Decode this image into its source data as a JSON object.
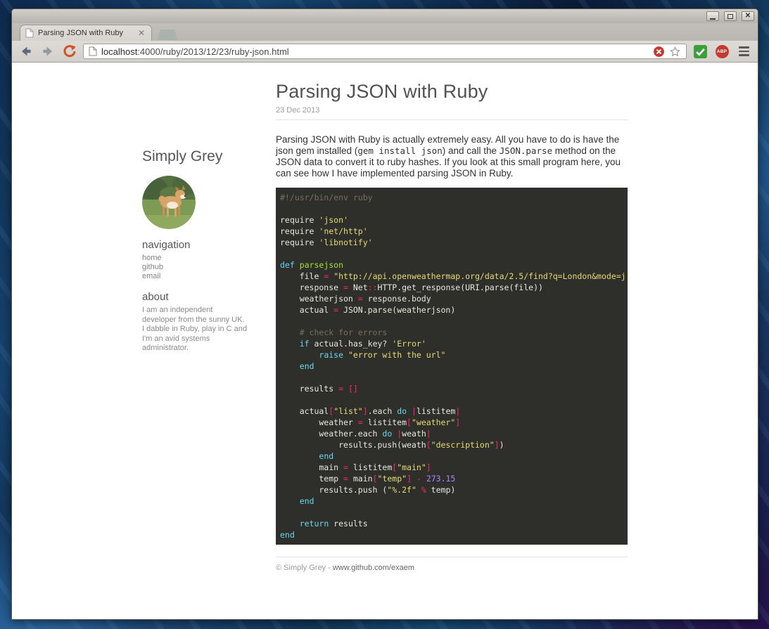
{
  "window_controls": {
    "minimize": "minimize",
    "maximize": "maximize",
    "close": "close"
  },
  "browser": {
    "tab_title": "Parsing JSON with Ruby",
    "url_domain": "localhost",
    "url_path": ":4000/ruby/2013/12/23/ruby-json.html",
    "abp_label": "ABP"
  },
  "sidebar": {
    "title": "Simply Grey",
    "nav_heading": "navigation",
    "nav_links": [
      {
        "label": "home"
      },
      {
        "label": "github"
      },
      {
        "label": "email"
      }
    ],
    "about_heading": "about",
    "about_text": "I am an independent developer from the sunny UK. I dabble in Ruby, play in C and I'm an avid systems administrator."
  },
  "post": {
    "title": "Parsing JSON with Ruby",
    "date": "23 Dec 2013",
    "intro": {
      "t1": "Parsing JSON with Ruby is actually extremely easy. All you have to do is have the json gem installed (",
      "c1": "gem install json",
      "t2": ") and call the ",
      "c2": "JSON.parse",
      "t3": " method on the JSON data to convert it to ruby hashes. If you look at this small program here, you can see how I have implemented parsing JSON in Ruby."
    },
    "code_theme": {
      "background": "#2e2e2a",
      "plain": "#e8e8e2",
      "comment": "#75715e",
      "string": "#e6db74",
      "keyword": "#66d9ef",
      "function": "#a6e22e",
      "operator": "#f92672",
      "number": "#ae81ff"
    },
    "code_lines": [
      [
        [
          "c",
          "#!/usr/bin/env ruby"
        ]
      ],
      [],
      [
        [
          "p",
          "require "
        ],
        [
          "s",
          "'json'"
        ]
      ],
      [
        [
          "p",
          "require "
        ],
        [
          "s",
          "'net/http'"
        ]
      ],
      [
        [
          "p",
          "require "
        ],
        [
          "s",
          "'libnotify'"
        ]
      ],
      [],
      [
        [
          "k",
          "def "
        ],
        [
          "f",
          "parsejson"
        ]
      ],
      [
        [
          "p",
          "    file "
        ],
        [
          "o",
          "="
        ],
        [
          "p",
          " "
        ],
        [
          "s",
          "\"http://api.openweathermap.org/data/2.5/find?q=London&mode=j"
        ]
      ],
      [
        [
          "p",
          "    response "
        ],
        [
          "o",
          "="
        ],
        [
          "p",
          " Net"
        ],
        [
          "o",
          "::"
        ],
        [
          "p",
          "HTTP.get_response(URI.parse(file))"
        ]
      ],
      [
        [
          "p",
          "    weatherjson "
        ],
        [
          "o",
          "="
        ],
        [
          "p",
          " response.body"
        ]
      ],
      [
        [
          "p",
          "    actual "
        ],
        [
          "o",
          "="
        ],
        [
          "p",
          " JSON.parse(weatherjson)"
        ]
      ],
      [],
      [
        [
          "p",
          "    "
        ],
        [
          "c",
          "# check for errors"
        ]
      ],
      [
        [
          "p",
          "    "
        ],
        [
          "k",
          "if"
        ],
        [
          "p",
          " actual.has_key? "
        ],
        [
          "s",
          "'Error'"
        ]
      ],
      [
        [
          "p",
          "        "
        ],
        [
          "k",
          "raise"
        ],
        [
          "p",
          " "
        ],
        [
          "s",
          "\"error with the url\""
        ]
      ],
      [
        [
          "p",
          "    "
        ],
        [
          "k",
          "end"
        ]
      ],
      [],
      [
        [
          "p",
          "    results "
        ],
        [
          "o",
          "="
        ],
        [
          "p",
          " "
        ],
        [
          "o",
          "[]"
        ]
      ],
      [],
      [
        [
          "p",
          "    actual"
        ],
        [
          "o",
          "["
        ],
        [
          "s",
          "\"list\""
        ],
        [
          "o",
          "]"
        ],
        [
          "p",
          ".each "
        ],
        [
          "k",
          "do"
        ],
        [
          "p",
          " "
        ],
        [
          "o",
          "|"
        ],
        [
          "p",
          "listitem"
        ],
        [
          "o",
          "|"
        ]
      ],
      [
        [
          "p",
          "        weather "
        ],
        [
          "o",
          "="
        ],
        [
          "p",
          " listitem"
        ],
        [
          "o",
          "["
        ],
        [
          "s",
          "\"weather\""
        ],
        [
          "o",
          "]"
        ]
      ],
      [
        [
          "p",
          "        weather.each "
        ],
        [
          "k",
          "do"
        ],
        [
          "p",
          " "
        ],
        [
          "o",
          "|"
        ],
        [
          "p",
          "weath"
        ],
        [
          "o",
          "|"
        ]
      ],
      [
        [
          "p",
          "            results.push(weath"
        ],
        [
          "o",
          "["
        ],
        [
          "s",
          "\"description\""
        ],
        [
          "o",
          "]"
        ],
        [
          "p",
          ")"
        ]
      ],
      [
        [
          "p",
          "        "
        ],
        [
          "k",
          "end"
        ]
      ],
      [
        [
          "p",
          "        main "
        ],
        [
          "o",
          "="
        ],
        [
          "p",
          " listitem"
        ],
        [
          "o",
          "["
        ],
        [
          "s",
          "\"main\""
        ],
        [
          "o",
          "]"
        ]
      ],
      [
        [
          "p",
          "        temp "
        ],
        [
          "o",
          "="
        ],
        [
          "p",
          " main"
        ],
        [
          "o",
          "["
        ],
        [
          "s",
          "\"temp\""
        ],
        [
          "o",
          "]"
        ],
        [
          "p",
          " "
        ],
        [
          "o",
          "-"
        ],
        [
          "p",
          " "
        ],
        [
          "n",
          "273.15"
        ]
      ],
      [
        [
          "p",
          "        results.push ("
        ],
        [
          "s",
          "\"%.2f\""
        ],
        [
          "p",
          " "
        ],
        [
          "o",
          "%"
        ],
        [
          "p",
          " temp)"
        ]
      ],
      [
        [
          "p",
          "    "
        ],
        [
          "k",
          "end"
        ]
      ],
      [],
      [
        [
          "p",
          "    "
        ],
        [
          "k",
          "return"
        ],
        [
          "p",
          " results"
        ]
      ],
      [
        [
          "k",
          "end"
        ]
      ]
    ],
    "footer_copyright": "© Simply Grey - ",
    "footer_link": "www.github.com/exaem"
  }
}
